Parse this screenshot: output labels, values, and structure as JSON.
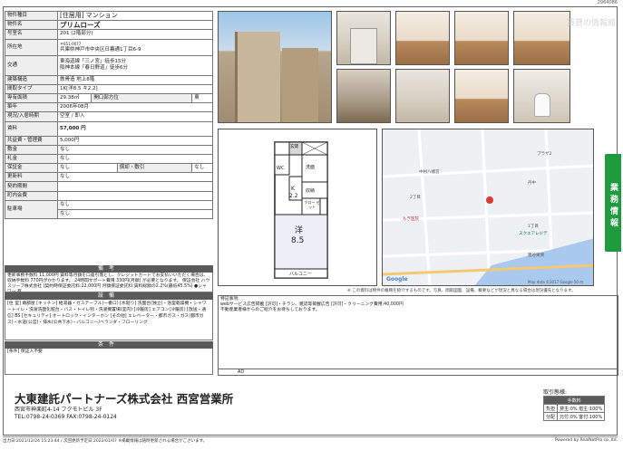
{
  "doc_id": "2964086",
  "watermark": "賃貸の情報館",
  "spec": {
    "type_label": "物件種目",
    "type_value": "[住居用] マンション",
    "name_label": "物件名",
    "name_value": "プリムローズ",
    "room_label": "号室名",
    "room_value": "201 (2階部分)",
    "addr_label": "所在地",
    "addr_zip": "〒651-0077",
    "addr_value": "兵庫県神戸市中央区日暮通1丁目6-9",
    "traffic_label": "交通",
    "traffic_1": "東海道線「三ノ宮」徒歩15分",
    "traffic_2": "阪神本線「春日野道」徒歩6分",
    "structure_label": "建築構造",
    "structure_value": "鉄骨造 地上8階",
    "layout_label": "間取タイプ",
    "layout_value": "1K[洋8.5 キ2.2]",
    "area_label": "専有面積",
    "area_value": "29.38㎡",
    "dir_label": "開口部方位",
    "dir_value": "東",
    "built_label": "築年",
    "built_value": "2006年08月",
    "status_label": "現況/入居時期",
    "status_value": "空室 / 即入",
    "rent_label": "賃料",
    "rent_value": "57,000 円",
    "common_label": "共益費・管理費",
    "common_value": "5,000円",
    "deposit_label": "敷金",
    "deposit_value": "なし",
    "key_label": "礼金",
    "key_value": "なし",
    "guarantee_label": "保証金",
    "guarantee_value": "なし",
    "amort_label": "償却・敷引",
    "amort_value": "なし",
    "renewal_label": "更新料",
    "renewal_value": "なし",
    "contract_label": "契約期間",
    "contract_value": "",
    "town_label": "町内会費",
    "town_value": "",
    "parking_label": "駐車場",
    "parking_1": "なし",
    "parking_2": "なし"
  },
  "sections": {
    "remarks_title": "備考",
    "remarks_text": "更新事務手数料 11,000円 賃料等月額を口座引落とし、クレジットカードでお支払いいただく場合は、収納手数料 770円がかかります。 24時間サポート費用 330円(月額) が必要となります。 保証会社 ハウスリーブ株式会社 (契約時保証委託料:22,000円 月額保証委託料:賃料総額の2.2%(最低45.5%) ●シャワー 有",
    "equip_title": "設備",
    "equip_text": "[住 室] 角部屋 [キッチン] 給湯器・ガステーブル(一番口) [水廻り] 洗面台(独立)・浴室乾燥機・シャワートイレ・洗濯洗面化粧台・バス・トイレ別・洗濯機置場(室内) [冷暖房] エアコン(冷暖房) [放送・通信] BS [セキュリティ] オートロック・インターホン [その他] エレベーター・都市ガス・ガス(都市ガス)・水道(公営)・排水(公共下水)・バルコニー/ベランダ・フローリング",
    "cond_title": "条件",
    "cond_text": "[条件] 保証人不要"
  },
  "floorplan": {
    "entrance": "玄関",
    "wc": "WC",
    "wash": "洗面",
    "kitchen": "K",
    "kitchen_size": "2.2",
    "storage": "収納",
    "closet": "クロー ゼット",
    "room": "洋",
    "room_size": "8.5",
    "balcony": "バルコニー"
  },
  "map": {
    "labels": [
      "中村八幡宮",
      "プラザ2",
      "丹中",
      "もぎ医院",
      "1丁目",
      "2丁目",
      "スクエアレジデ",
      "豊谷東側",
      "Google"
    ],
    "copyright": "Map data ©2017 Google 50 m"
  },
  "map_note": "※ この資料は物件の概略を紹介するものです。写真、間取図面、設備、概要などが現況と異なる場合は現況優先となります。",
  "side_tab": "業務情報",
  "notes": {
    "title": "特記事項:",
    "line1": "webサービス広告掲載 [許可]・チラシ、雑誌等掲載広告 [許可]・クリーニング費用:40,000円",
    "line2": "不動産業者様からのご紹介をお待ちしております。"
  },
  "ad_label": "AD",
  "company": {
    "name": "大東建託パートナーズ株式会社 西宮営業所",
    "addr": "西宮市神楽町4-14 フクモトビル 3F",
    "tel": "TEL:0798-24-0369 FAX:0798-24-0124"
  },
  "fee": {
    "title": "取引態様:",
    "head": "手数料",
    "r1a": "負担",
    "r1b": "貸主:0% 借主:100%",
    "r2a": "分配",
    "r2b": "元付:0% 客付:100%"
  },
  "footer": {
    "left": "出力日:2021/12/24 15:23:44 / 次回更新予定日:2022/01/07 ※掲載情報は随時更新される場合がございます。",
    "right": "Powered by RealNetPro co.,ltd."
  }
}
